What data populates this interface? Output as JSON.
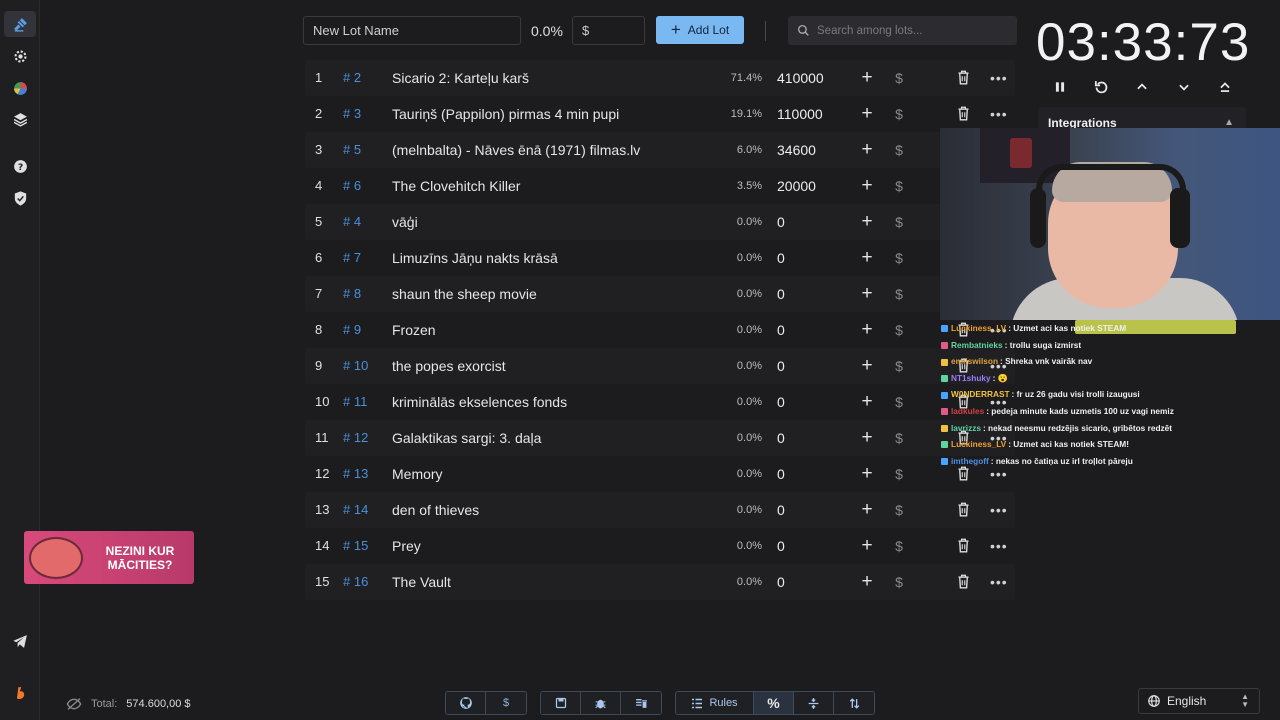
{
  "topbar": {
    "lot_name_placeholder": "New Lot Name",
    "percent": "0.0%",
    "amount_placeholder": "$",
    "add_lot_label": "Add Lot",
    "search_placeholder": "Search among lots..."
  },
  "lots": [
    {
      "rank": "1",
      "id": "# 2",
      "name": "Sicario 2: Karteļu karš",
      "percent": "71.4%",
      "amount": "410000"
    },
    {
      "rank": "2",
      "id": "# 3",
      "name": "Tauriņš (Pappilon) pirmas 4 min pupi",
      "percent": "19.1%",
      "amount": "110000"
    },
    {
      "rank": "3",
      "id": "# 5",
      "name": "(melnbalta) - Nāves ēnā (1971) filmas.lv",
      "percent": "6.0%",
      "amount": "34600"
    },
    {
      "rank": "4",
      "id": "# 6",
      "name": "The Clovehitch Killer",
      "percent": "3.5%",
      "amount": "20000"
    },
    {
      "rank": "5",
      "id": "# 4",
      "name": "vāģi",
      "percent": "0.0%",
      "amount": "0"
    },
    {
      "rank": "6",
      "id": "# 7",
      "name": "Limuzīns Jāņu nakts krāsā",
      "percent": "0.0%",
      "amount": "0"
    },
    {
      "rank": "7",
      "id": "# 8",
      "name": "shaun the sheep movie",
      "percent": "0.0%",
      "amount": "0"
    },
    {
      "rank": "8",
      "id": "# 9",
      "name": "Frozen",
      "percent": "0.0%",
      "amount": "0"
    },
    {
      "rank": "9",
      "id": "# 10",
      "name": "the popes exorcist",
      "percent": "0.0%",
      "amount": "0"
    },
    {
      "rank": "10",
      "id": "# 11",
      "name": "kriminālās ekselences fonds",
      "percent": "0.0%",
      "amount": "0"
    },
    {
      "rank": "11",
      "id": "# 12",
      "name": "Galaktikas sargi: 3. daļa",
      "percent": "0.0%",
      "amount": "0"
    },
    {
      "rank": "12",
      "id": "# 13",
      "name": "Memory",
      "percent": "0.0%",
      "amount": "0"
    },
    {
      "rank": "13",
      "id": "# 14",
      "name": "den of thieves",
      "percent": "0.0%",
      "amount": "0"
    },
    {
      "rank": "14",
      "id": "# 15",
      "name": "Prey",
      "percent": "0.0%",
      "amount": "0"
    },
    {
      "rank": "15",
      "id": "# 16",
      "name": "The Vault",
      "percent": "0.0%",
      "amount": "0"
    }
  ],
  "row_actions": {
    "plus": "+",
    "dollar": "$",
    "more": "•••"
  },
  "timer": {
    "value": "03:33:73"
  },
  "integrations": {
    "label": "Integrations"
  },
  "chat": [
    {
      "user": "Luckiness_LV",
      "user_color": "#f0a030",
      "text": ": Uzmet aci kas notiek STEAM"
    },
    {
      "user": "Rembatnieks",
      "user_color": "#5fd4a0",
      "text": ": trollu suga izmirst"
    },
    {
      "user": "emilswilson",
      "user_color": "#e0a040",
      "text": ": Shreka vnk vairāk nav"
    },
    {
      "user": "NT1shuky",
      "user_color": "#9a7cff",
      "text": ": 😮"
    },
    {
      "user": "W0NDERRAST",
      "user_color": "#f0c040",
      "text": ": fr uz 26 gadu visi trolli izaugusi"
    },
    {
      "user": "ladkules",
      "user_color": "#d04040",
      "text": ": pedeja minute kads uzmetis 100 uz vagi nemiz"
    },
    {
      "user": "lavrizzs",
      "user_color": "#5fd4a0",
      "text": ": nekad neesmu redzējis sicario, gribētos redzēt"
    },
    {
      "user": "Luckiness_LV",
      "user_color": "#f0a030",
      "text": ": Uzmet aci kas notiek STEAM!"
    },
    {
      "user": "imthegoff",
      "user_color": "#4a90e0",
      "text": ": nekas no čatiņa uz irl troļlot pāreju"
    }
  ],
  "promo": {
    "line1": "NEZINI KUR",
    "line2": "MĀCITIES?"
  },
  "footer": {
    "total_label": "Total:",
    "total_value": "574.600,00 $",
    "dollar_label": "$",
    "rules_label": "Rules",
    "percent_label": "%",
    "language": "English"
  },
  "colors": {
    "accent": "#79b8f0",
    "lot_id": "#4a90d9",
    "background": "#1c1c1e"
  }
}
